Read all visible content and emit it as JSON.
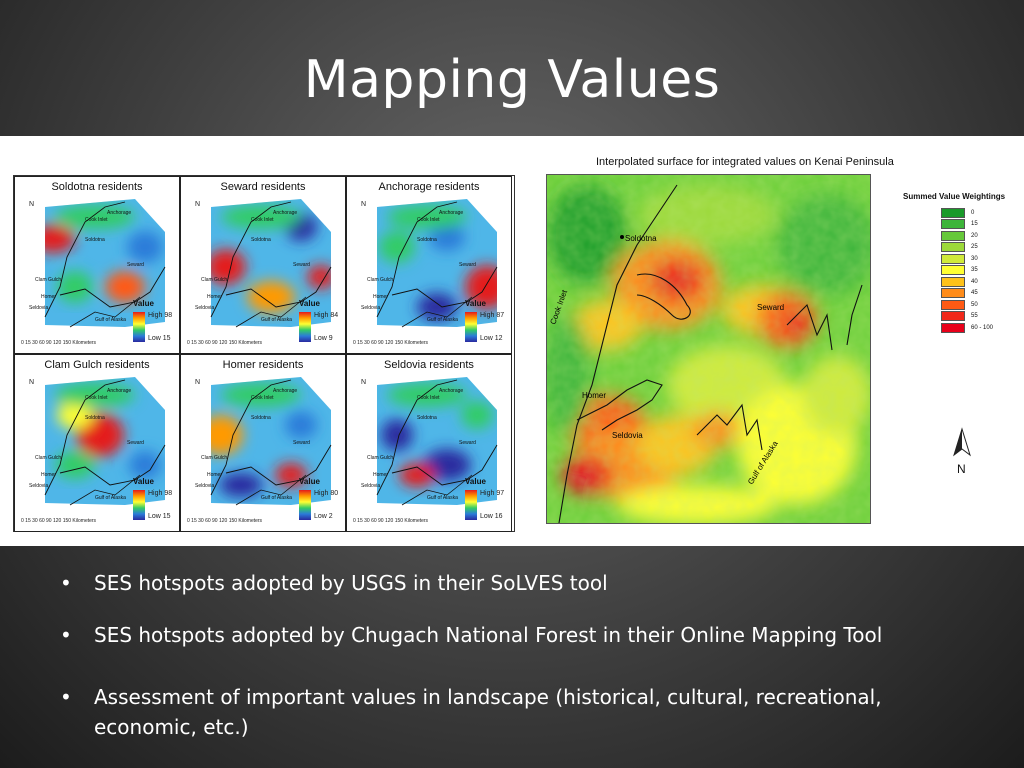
{
  "slide": {
    "title": "Mapping Values",
    "bullets": [
      "SES hotspots adopted by USGS in their SoLVES tool",
      "SES hotspots adopted by Chugach National Forest in their Online Mapping Tool",
      "Assessment of important values in landscape (historical, cultural, recreational, economic, etc.)"
    ]
  },
  "small_maps": {
    "panels": [
      {
        "title": "Soldotna residents",
        "high": "High 98",
        "low": "Low 15"
      },
      {
        "title": "Seward residents",
        "high": "High 84",
        "low": "Low 9"
      },
      {
        "title": "Anchorage residents",
        "high": "High 87",
        "low": "Low 12"
      },
      {
        "title": "Clam Gulch residents",
        "high": "High 98",
        "low": "Low 15"
      },
      {
        "title": "Homer residents",
        "high": "High 80",
        "low": "Low 2"
      },
      {
        "title": "Seldovia residents",
        "high": "High 97",
        "low": "Low 16"
      }
    ],
    "legend_title": "Value",
    "scale_text": "0 15 30   60   90   120  150 Kilometers",
    "north": "N",
    "place_labels": [
      "Anchorage",
      "Cook Inlet",
      "Soldotna",
      "Clam Gulch",
      "Homer",
      "Seldovia",
      "Seward",
      "Gulf of Alaska"
    ]
  },
  "big_map": {
    "title": "Interpolated surface for integrated values on Kenai Peninsula",
    "legend_title": "Summed Value Weightings",
    "legend": [
      {
        "label": "0",
        "color": "#1a9a2a"
      },
      {
        "label": "15",
        "color": "#3db53a"
      },
      {
        "label": "20",
        "color": "#66c83a"
      },
      {
        "label": "25",
        "color": "#9cd93a"
      },
      {
        "label": "30",
        "color": "#d0ea3a"
      },
      {
        "label": "35",
        "color": "#ffff33"
      },
      {
        "label": "40",
        "color": "#ffc21a"
      },
      {
        "label": "45",
        "color": "#ff8c1a"
      },
      {
        "label": "50",
        "color": "#ff5a14"
      },
      {
        "label": "55",
        "color": "#f0281a"
      },
      {
        "label": "60 - 100",
        "color": "#e8001a"
      }
    ],
    "labels": {
      "soldotna": "Soldotna",
      "seward": "Seward",
      "homer": "Homer",
      "seldovia": "Seldovia",
      "cook_inlet": "Cook Inlet",
      "gulf": "Gulf of Alaska"
    },
    "north": "N"
  }
}
